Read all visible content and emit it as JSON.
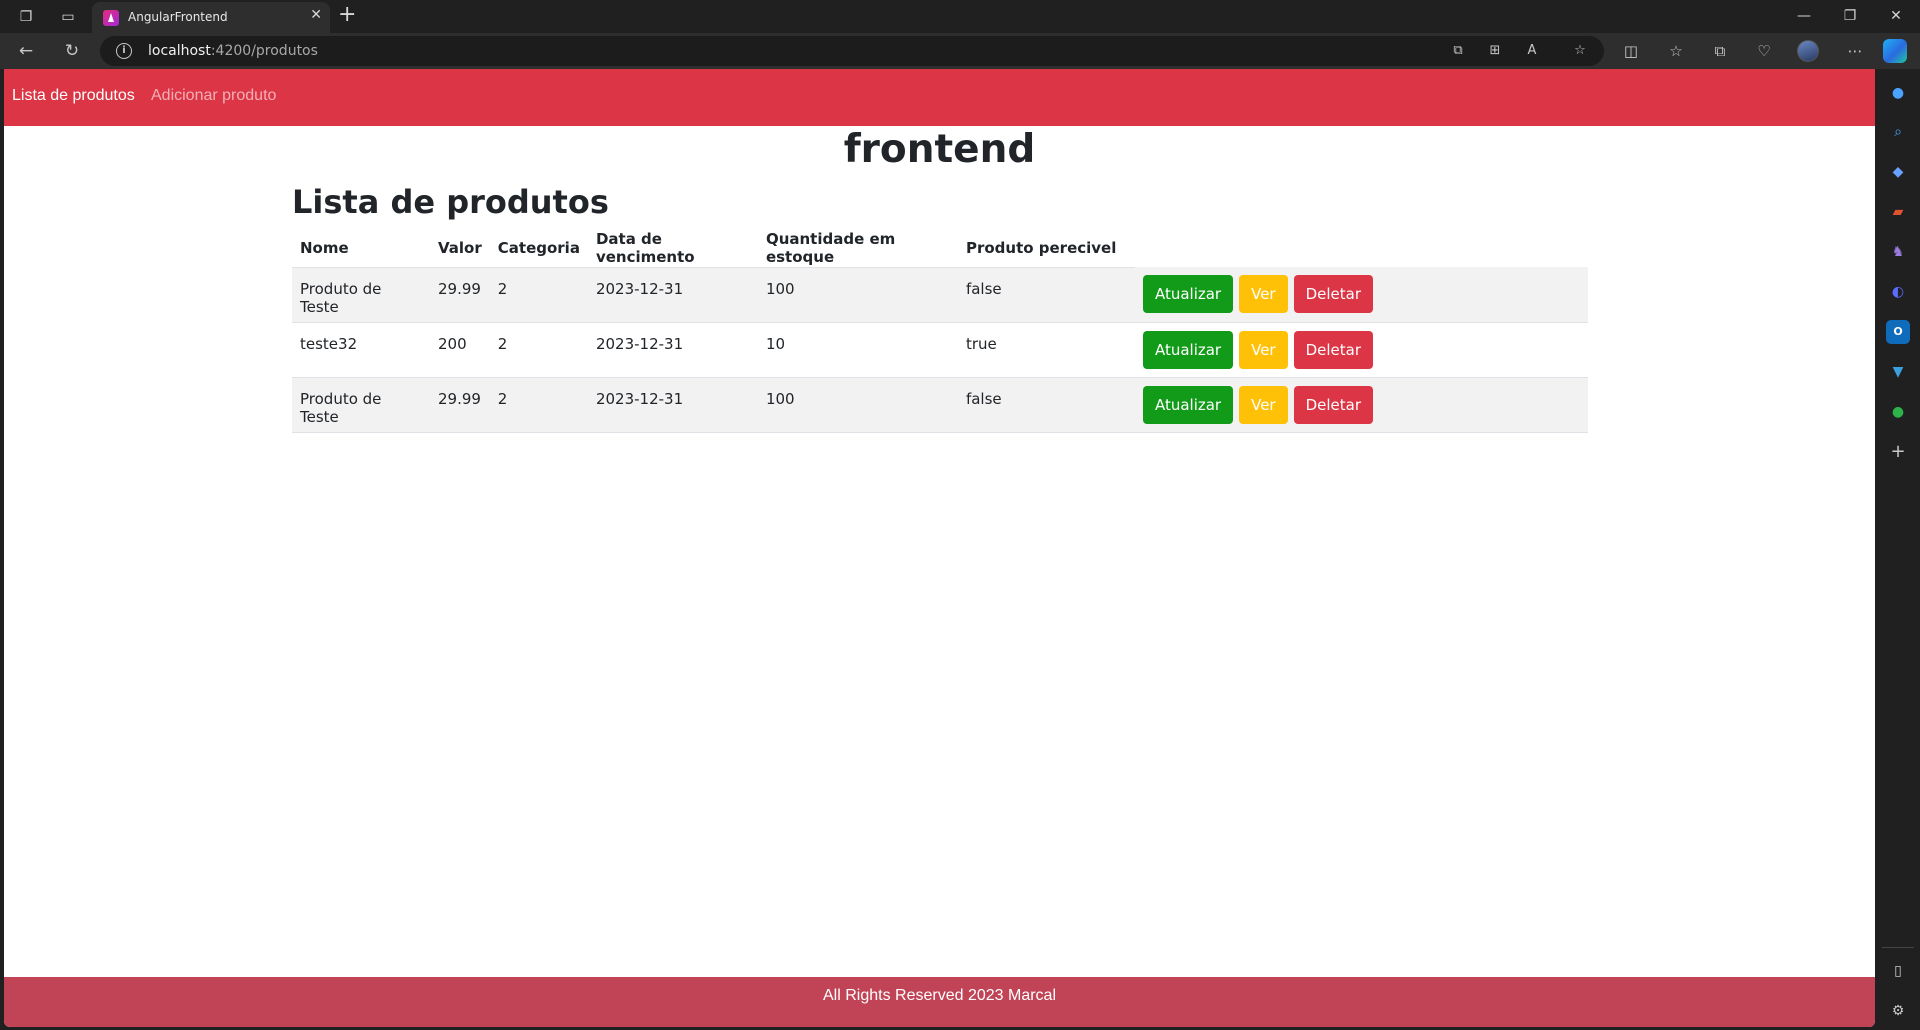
{
  "browser": {
    "tab_title": "AngularFrontend",
    "url_host": "localhost",
    "url_path": ":4200/produtos",
    "icons": {
      "workspaces": "workspaces-icon",
      "tab_actions": "tab-actions-icon",
      "close_tab": "close-icon",
      "new_tab": "plus-icon",
      "back": "back-arrow-icon",
      "refresh": "refresh-icon",
      "site_info": "info-icon"
    }
  },
  "navbar": {
    "active_link": "Lista de produtos",
    "inactive_link": "Adicionar produto",
    "color": "#dc3545"
  },
  "main": {
    "app_title": "frontend",
    "list_title": "Lista de produtos"
  },
  "table": {
    "headers": [
      "Nome",
      "Valor",
      "Categoria",
      "Data de vencimento",
      "Quantidade em estoque",
      "Produto perecivel"
    ],
    "rows": [
      {
        "nome": "Produto de Teste",
        "valor": "29.99",
        "categoria": "2",
        "data": "2023-12-31",
        "quantidade": "100",
        "perecivel": "false"
      },
      {
        "nome": "teste32",
        "valor": "200",
        "categoria": "2",
        "data": "2023-12-31",
        "quantidade": "10",
        "perecivel": "true"
      },
      {
        "nome": "Produto de Teste",
        "valor": "29.99",
        "categoria": "2",
        "data": "2023-12-31",
        "quantidade": "100",
        "perecivel": "false"
      }
    ],
    "actions": {
      "update": "Atualizar",
      "view": "Ver",
      "delete": "Deletar"
    },
    "action_colors": {
      "update": "#119b19",
      "view": "#ffc107",
      "delete": "#dc3545"
    }
  },
  "footer": {
    "text": "All Rights Reserved 2023 Marcal",
    "color": "#c04456"
  }
}
